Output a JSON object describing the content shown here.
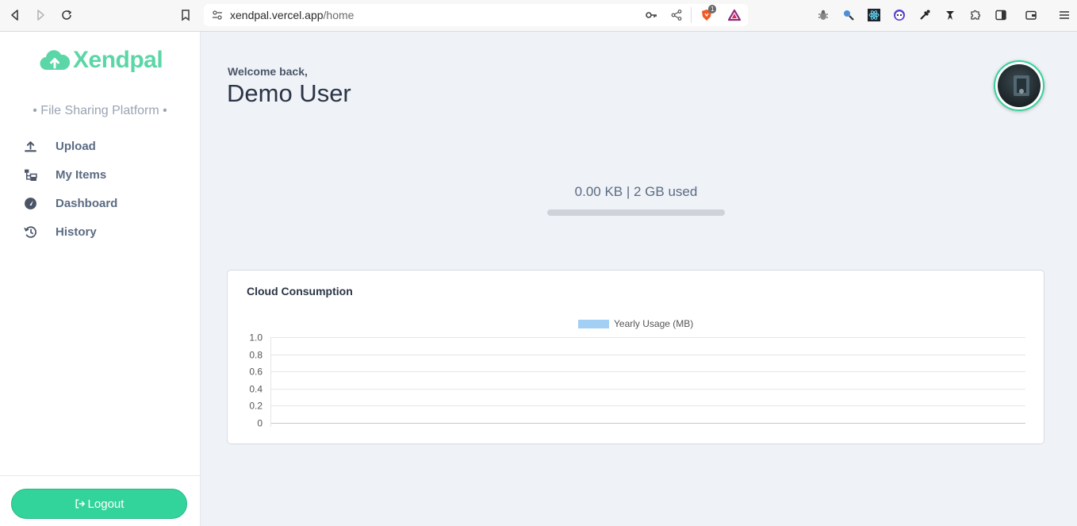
{
  "browser": {
    "url_host": "xendpal.vercel.app",
    "url_path": "/home",
    "brave_badge": "1"
  },
  "sidebar": {
    "brand": "Xendpal",
    "tagline": "• File Sharing Platform •",
    "items": [
      {
        "label": "Upload",
        "icon": "upload-icon"
      },
      {
        "label": "My Items",
        "icon": "folder-tree-icon"
      },
      {
        "label": "Dashboard",
        "icon": "gauge-icon"
      },
      {
        "label": "History",
        "icon": "history-icon"
      }
    ],
    "logout_label": "Logout"
  },
  "header": {
    "welcome": "Welcome back,",
    "user_name": "Demo User"
  },
  "storage": {
    "label": "0.00 KB | 2 GB used",
    "used_fraction": 0
  },
  "colors": {
    "brand": "#5bd6a7",
    "accent": "#33d49b",
    "series": "#a2cff3"
  },
  "card": {
    "title": "Cloud Consumption"
  },
  "chart_data": {
    "type": "bar",
    "categories": [],
    "series": [
      {
        "name": "Yearly Usage (MB)",
        "values": []
      }
    ],
    "ylim": [
      0,
      1.0
    ],
    "yticks": [
      "1.0",
      "0.8",
      "0.6",
      "0.4",
      "0.2",
      "0"
    ],
    "grid": true,
    "legend": "top-center"
  }
}
